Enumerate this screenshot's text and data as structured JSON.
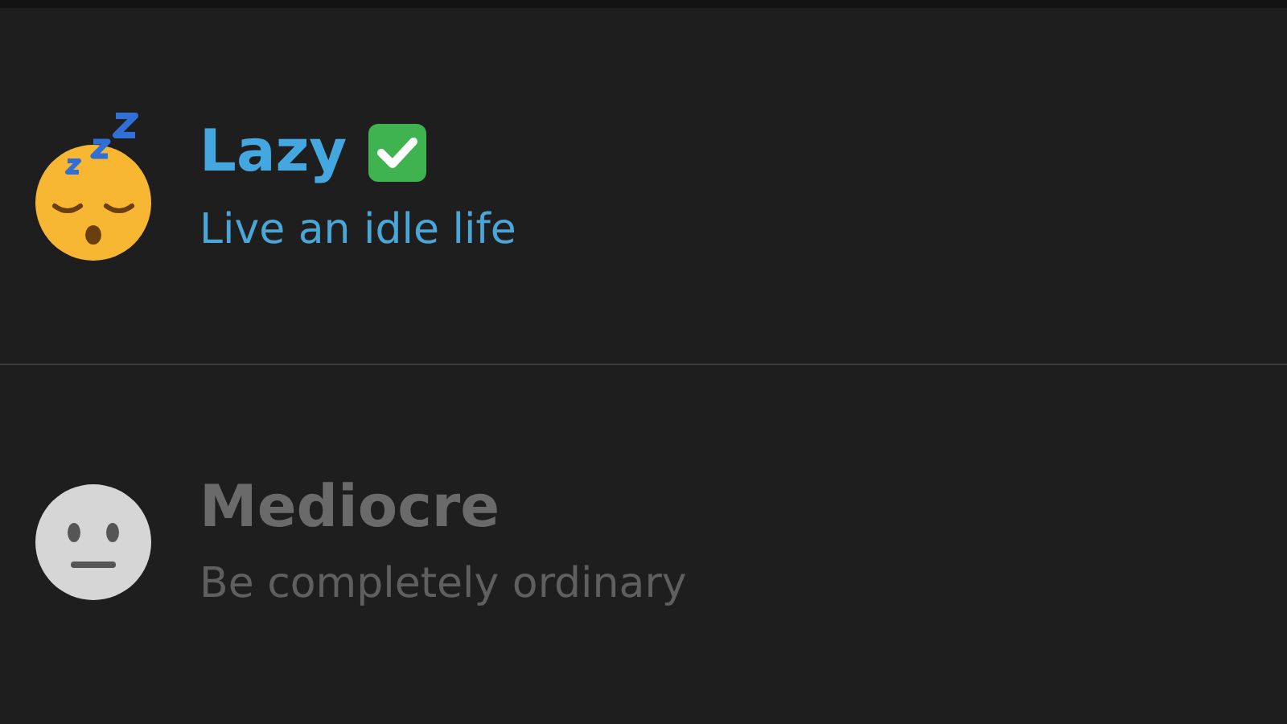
{
  "options": [
    {
      "title": "Lazy",
      "subtitle": "Live an idle life",
      "selected": true
    },
    {
      "title": "Mediocre",
      "subtitle": "Be completely ordinary",
      "selected": false
    }
  ]
}
